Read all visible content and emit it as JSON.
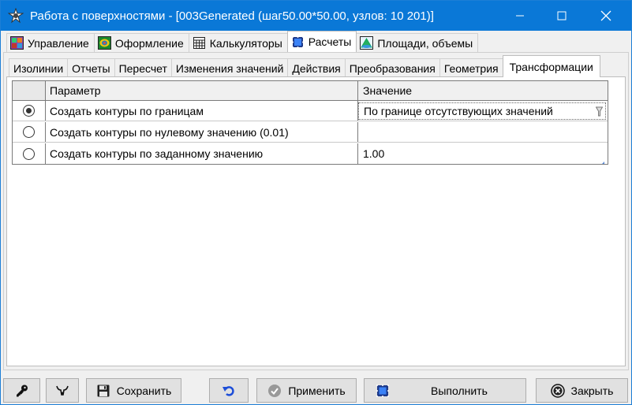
{
  "window": {
    "title": "Работа с поверхностями - [003Generated (шаг50.00*50.00, узлов: 10 201)]",
    "minimize_glyph": "—",
    "maximize_glyph": "☐",
    "close_glyph": "✕"
  },
  "top_tabs": [
    {
      "label": "Управление",
      "icon": "grid-colored-icon"
    },
    {
      "label": "Оформление",
      "icon": "contour-colored-icon"
    },
    {
      "label": "Калькуляторы",
      "icon": "calculator-icon"
    },
    {
      "label": "Расчеты",
      "icon": "dotted-square-icon",
      "active": true
    },
    {
      "label": "Площади, объемы",
      "icon": "volume-icon"
    }
  ],
  "sub_tabs": [
    {
      "label": "Изолинии"
    },
    {
      "label": "Отчеты"
    },
    {
      "label": "Пересчет"
    },
    {
      "label": "Изменения значений"
    },
    {
      "label": "Действия"
    },
    {
      "label": "Преобразования"
    },
    {
      "label": "Геометрия"
    },
    {
      "label": "Трансформации",
      "active": true
    }
  ],
  "grid": {
    "headers": {
      "param": "Параметр",
      "value": "Значение"
    },
    "rows": [
      {
        "selected": true,
        "param": "Создать контуры по границам",
        "value": "По границе отсутствующих значений"
      },
      {
        "selected": false,
        "param": "Создать контуры по нулевому значению (0.01)",
        "value": ""
      },
      {
        "selected": false,
        "param": "Создать контуры по заданному значению",
        "value": "1.00"
      }
    ]
  },
  "toolbar": {
    "save_label": "Сохранить",
    "apply_label": "Применить",
    "run_label": "Выполнить",
    "close_label": "Закрыть"
  },
  "colors": {
    "titlebar": "#0a78d7",
    "window_bg": "#f0f0f0",
    "button_bg": "#e1e1e1"
  }
}
